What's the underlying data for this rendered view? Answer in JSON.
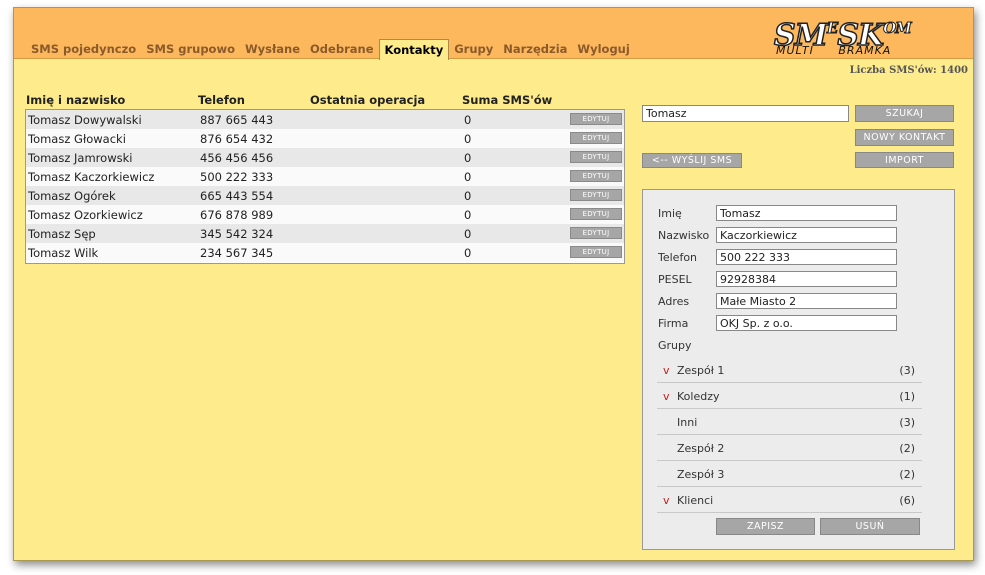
{
  "nav": {
    "tabs": [
      {
        "label": "SMS pojedynczo",
        "active": false
      },
      {
        "label": "SMS grupowo",
        "active": false
      },
      {
        "label": "Wysłane",
        "active": false
      },
      {
        "label": "Odebrane",
        "active": false
      },
      {
        "label": "Kontakty",
        "active": true
      },
      {
        "label": "Grupy",
        "active": false
      },
      {
        "label": "Narzędzia",
        "active": false
      },
      {
        "label": "Wyloguj",
        "active": false
      }
    ]
  },
  "logo": {
    "main_a": "SM",
    "main_sup": "E",
    "main_b": "SK",
    "main_c": "OM",
    "sub_a": "MULTI",
    "sub_b": "BRAMKA"
  },
  "sms_count": "Liczba SMS'ów: 1400",
  "table": {
    "headers": [
      "Imię i nazwisko",
      "Telefon",
      "Ostatnia operacja",
      "Suma SMS'ów"
    ],
    "edit_label": "EDYTUJ",
    "rows": [
      {
        "name": "Tomasz Dowywalski",
        "phone": "887 665 443",
        "last": "",
        "sum": "0"
      },
      {
        "name": "Tomasz Głowacki",
        "phone": "876 654 432",
        "last": "",
        "sum": "0"
      },
      {
        "name": "Tomasz Jamrowski",
        "phone": "456 456 456",
        "last": "",
        "sum": "0"
      },
      {
        "name": "Tomasz Kaczorkiewicz",
        "phone": "500 222 333",
        "last": "",
        "sum": "0"
      },
      {
        "name": "Tomasz Ogórek",
        "phone": "665 443 554",
        "last": "",
        "sum": "0"
      },
      {
        "name": "Tomasz Ozorkiewicz",
        "phone": "676 878 989",
        "last": "",
        "sum": "0"
      },
      {
        "name": "Tomasz Sęp",
        "phone": "345 542 324",
        "last": "",
        "sum": "0"
      },
      {
        "name": "Tomasz Wilk",
        "phone": "234 567 345",
        "last": "",
        "sum": "0"
      }
    ]
  },
  "search": {
    "value": "Tomasz",
    "search_label": "SZUKAJ",
    "new_contact_label": "NOWY KONTAKT",
    "import_label": "IMPORT",
    "send_sms_label": "<-- WYŚLIJ SMS"
  },
  "form": {
    "fields": [
      {
        "label": "Imię",
        "value": "Tomasz"
      },
      {
        "label": "Nazwisko",
        "value": "Kaczorkiewicz"
      },
      {
        "label": "Telefon",
        "value": "500 222 333"
      },
      {
        "label": "PESEL",
        "value": "92928384"
      },
      {
        "label": "Adres",
        "value": "Małe Miasto 2"
      },
      {
        "label": "Firma",
        "value": "OKJ Sp. z o.o."
      }
    ],
    "groups_label": "Grupy",
    "groups": [
      {
        "name": "Zespół 1",
        "count": "(3)",
        "checked": true,
        "mark": "v"
      },
      {
        "name": "Koledzy",
        "count": "(1)",
        "checked": true,
        "mark": "v"
      },
      {
        "name": "Inni",
        "count": "(3)",
        "checked": false,
        "mark": ""
      },
      {
        "name": "Zespół 2",
        "count": "(2)",
        "checked": false,
        "mark": ""
      },
      {
        "name": "Zespół 3",
        "count": "(2)",
        "checked": false,
        "mark": ""
      },
      {
        "name": "Klienci",
        "count": "(6)",
        "checked": true,
        "mark": "v"
      }
    ],
    "save_label": "ZAPISZ",
    "delete_label": "USUŃ"
  },
  "colors": {
    "header_bg": "#fdb85e",
    "page_bg": "#fdeb8c",
    "button_gray": "#a6a6a6",
    "check_red": "#c02020"
  }
}
